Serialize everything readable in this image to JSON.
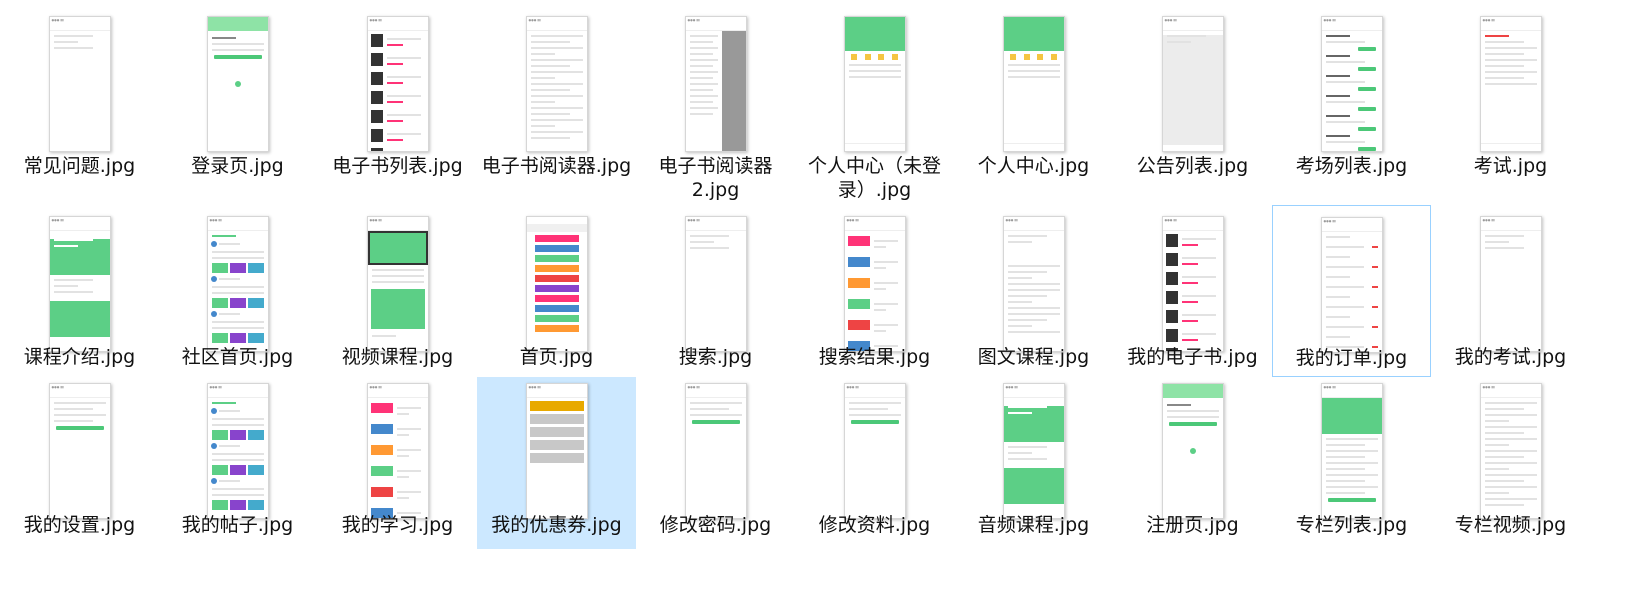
{
  "files": [
    {
      "label": "常见问题.jpg",
      "thumb": "list"
    },
    {
      "label": "登录页.jpg",
      "thumb": "login"
    },
    {
      "label": "电子书列表.jpg",
      "thumb": "books"
    },
    {
      "label": "电子书阅读器.jpg",
      "thumb": "reader"
    },
    {
      "label": "电子书阅读器2.jpg",
      "thumb": "reader2"
    },
    {
      "label": "个人中心（未登录）.jpg",
      "thumb": "profile"
    },
    {
      "label": "个人中心.jpg",
      "thumb": "profile"
    },
    {
      "label": "公告列表.jpg",
      "thumb": "grey"
    },
    {
      "label": "考场列表.jpg",
      "thumb": "exams"
    },
    {
      "label": "考试.jpg",
      "thumb": "quiz"
    },
    {
      "label": "课程介绍.jpg",
      "thumb": "course"
    },
    {
      "label": "社区首页.jpg",
      "thumb": "community"
    },
    {
      "label": "视频课程.jpg",
      "thumb": "video"
    },
    {
      "label": "首页.jpg",
      "thumb": "home"
    },
    {
      "label": "搜索.jpg",
      "thumb": "list"
    },
    {
      "label": "搜索结果.jpg",
      "thumb": "courses"
    },
    {
      "label": "图文课程.jpg",
      "thumb": "article"
    },
    {
      "label": "我的电子书.jpg",
      "thumb": "books"
    },
    {
      "label": "我的订单.jpg",
      "thumb": "orders"
    },
    {
      "label": "我的考试.jpg",
      "thumb": "list"
    },
    {
      "label": "我的设置.jpg",
      "thumb": "settings"
    },
    {
      "label": "我的帖子.jpg",
      "thumb": "community"
    },
    {
      "label": "我的学习.jpg",
      "thumb": "courses"
    },
    {
      "label": "我的优惠券.jpg",
      "thumb": "coupons"
    },
    {
      "label": "修改密码.jpg",
      "thumb": "form"
    },
    {
      "label": "修改资料.jpg",
      "thumb": "form"
    },
    {
      "label": "音频课程.jpg",
      "thumb": "course"
    },
    {
      "label": "注册页.jpg",
      "thumb": "login"
    },
    {
      "label": "专栏列表.jpg",
      "thumb": "column"
    },
    {
      "label": "专栏视频.jpg",
      "thumb": "reader"
    }
  ]
}
